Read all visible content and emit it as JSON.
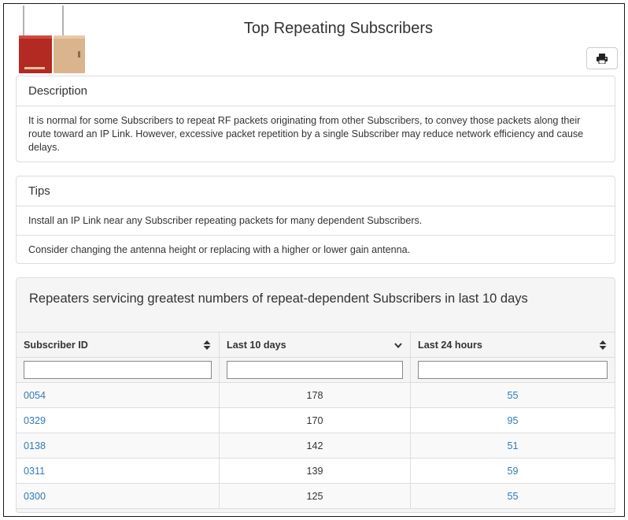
{
  "header": {
    "title": "Top Repeating Subscribers",
    "print_icon": "print-icon",
    "product_image_icon": "subscriber-devices-image"
  },
  "description": {
    "heading": "Description",
    "body": "It is normal for some Subscribers to repeat RF packets originating from other Subscribers, to convey those packets along their route toward an IP Link. However, excessive packet repetition by a single Subscriber may reduce network efficiency and cause delays."
  },
  "tips": {
    "heading": "Tips",
    "items": [
      "Install an IP Link near any Subscriber repeating packets for many dependent Subscribers.",
      "Consider changing the antenna height or replacing with a higher or lower gain antenna."
    ]
  },
  "table": {
    "title": "Repeaters servicing greatest numbers of repeat-dependent Subscribers in last 10 days",
    "columns": [
      {
        "label": "Subscriber ID",
        "sort_icon": "sort-both-icon"
      },
      {
        "label": "Last 10 days",
        "sort_icon": "sort-desc-icon"
      },
      {
        "label": "Last 24 hours",
        "sort_icon": "sort-both-icon"
      }
    ],
    "filters": [
      "",
      "",
      ""
    ],
    "rows": [
      {
        "id": "0054",
        "last10": "178",
        "last24": "55"
      },
      {
        "id": "0329",
        "last10": "170",
        "last24": "95"
      },
      {
        "id": "0138",
        "last10": "142",
        "last24": "51"
      },
      {
        "id": "0311",
        "last10": "139",
        "last24": "59"
      },
      {
        "id": "0300",
        "last10": "125",
        "last24": "55"
      }
    ]
  },
  "colors": {
    "link": "#337ab7",
    "border": "#dddddd",
    "text": "#333333",
    "panel_bg": "#f5f5f5",
    "device_red": "#b22a22",
    "device_tan": "#d9b48c"
  }
}
